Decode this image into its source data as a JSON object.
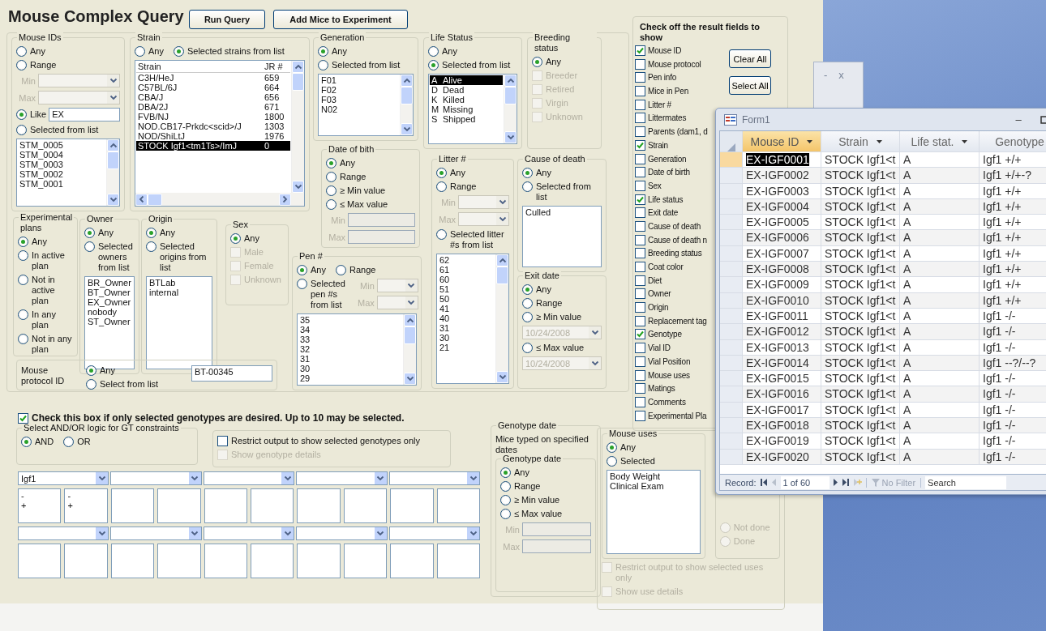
{
  "title": "Mouse Complex Query",
  "toolbar": [
    "Run Query",
    "Add Mice to Experiment"
  ],
  "groups": [
    {
      "title": "Mouse IDs",
      "items": [
        {
          "kind": "radio",
          "label": "Any",
          "selected": false,
          "disabled": false
        },
        {
          "kind": "radio",
          "label": "Range",
          "selected": false,
          "disabled": false
        },
        {
          "kind": "combo",
          "label": "Min",
          "disabled": true
        },
        {
          "kind": "combo",
          "label": "Max",
          "disabled": true
        },
        {
          "kind": "radio_input",
          "label": "Like",
          "value": "EX",
          "selected": true,
          "disabled": false
        },
        {
          "kind": "radio",
          "label": "Selected from list",
          "selected": false,
          "disabled": false
        },
        {
          "kind": "list",
          "rows": [
            {
              "cells": [
                "STM_0005"
              ],
              "selected": false
            },
            {
              "cells": [
                "STM_0004"
              ],
              "selected": false
            },
            {
              "cells": [
                "STM_0003"
              ],
              "selected": false
            },
            {
              "cells": [
                "STM_0002"
              ],
              "selected": false
            },
            {
              "cells": [
                "STM_0001"
              ],
              "selected": false
            }
          ]
        }
      ]
    },
    {
      "title": "Strain",
      "items": [
        {
          "kind": "row",
          "items": [
            {
              "kind": "radio",
              "label": "Any",
              "selected": false,
              "disabled": false
            },
            {
              "kind": "radio",
              "label": "Selected strains from list",
              "selected": true,
              "disabled": false
            }
          ]
        },
        {
          "kind": "list",
          "header": [
            "Strain",
            "JR #"
          ],
          "rows": [
            {
              "cells": [
                "C3H/HeJ",
                "659"
              ],
              "selected": false
            },
            {
              "cells": [
                "C57BL/6J",
                "664"
              ],
              "selected": false
            },
            {
              "cells": [
                "CBA/J",
                "656"
              ],
              "selected": false
            },
            {
              "cells": [
                "DBA/2J",
                "671"
              ],
              "selected": false
            },
            {
              "cells": [
                "FVB/NJ",
                "1800"
              ],
              "selected": false
            },
            {
              "cells": [
                "NOD.CB17-Prkdc<scid>/J",
                "1303"
              ],
              "selected": false
            },
            {
              "cells": [
                "NOD/ShiLtJ",
                "1976"
              ],
              "selected": false
            },
            {
              "cells": [
                "STOCK Igf1<tm1Ts>/ImJ",
                "0"
              ],
              "selected": true
            }
          ]
        }
      ]
    },
    {
      "title": "Generation",
      "items": [
        {
          "kind": "radio",
          "label": "Any",
          "selected": true,
          "disabled": false
        },
        {
          "kind": "radio",
          "label": "Selected from list",
          "selected": false,
          "disabled": false
        },
        {
          "kind": "list",
          "rows": [
            {
              "cells": [
                "F01"
              ],
              "selected": false
            },
            {
              "cells": [
                "F02"
              ],
              "selected": false
            },
            {
              "cells": [
                "F03"
              ],
              "selected": false
            },
            {
              "cells": [
                "N02"
              ],
              "selected": false
            }
          ]
        }
      ]
    },
    {
      "title": "Life Status",
      "items": [
        {
          "kind": "radio",
          "label": "Any",
          "selected": false,
          "disabled": false
        },
        {
          "kind": "radio",
          "label": "Selected from list",
          "selected": true,
          "disabled": false
        },
        {
          "kind": "list",
          "rows": [
            {
              "cells": [
                "A",
                "Alive"
              ],
              "selected": true
            },
            {
              "cells": [
                "D",
                "Dead"
              ],
              "selected": false
            },
            {
              "cells": [
                "K",
                "Killed"
              ],
              "selected": false
            },
            {
              "cells": [
                "M",
                "Missing"
              ],
              "selected": false
            },
            {
              "cells": [
                "S",
                "Shipped"
              ],
              "selected": false
            }
          ]
        }
      ]
    },
    {
      "title": "Breeding status",
      "items": [
        {
          "kind": "radio",
          "label": "Any",
          "selected": true,
          "disabled": false
        },
        {
          "kind": "check",
          "label": "Breeder",
          "checked": false,
          "disabled": true
        },
        {
          "kind": "check",
          "label": "Retired",
          "checked": false,
          "disabled": true
        },
        {
          "kind": "check",
          "label": "Virgin",
          "checked": false,
          "disabled": true
        },
        {
          "kind": "check",
          "label": "Unknown",
          "checked": false,
          "disabled": true
        }
      ]
    },
    {
      "title": "Date of bith",
      "items": [
        {
          "kind": "radio",
          "label": "Any",
          "selected": true,
          "disabled": false
        },
        {
          "kind": "radio",
          "label": "Range",
          "selected": false,
          "disabled": false
        },
        {
          "kind": "radio",
          "label": "≥ Min value",
          "selected": false,
          "disabled": false
        },
        {
          "kind": "radio",
          "label": "≤ Max value",
          "selected": false,
          "disabled": false
        },
        {
          "kind": "field",
          "label": "Min",
          "disabled": true
        },
        {
          "kind": "field",
          "label": "Max",
          "disabled": true
        }
      ]
    },
    {
      "title": "Litter #",
      "items": [
        {
          "kind": "radio",
          "label": "Any",
          "selected": true,
          "disabled": false
        },
        {
          "kind": "radio",
          "label": "Range",
          "selected": false,
          "disabled": false
        },
        {
          "kind": "combo",
          "label": "Min",
          "disabled": true
        },
        {
          "kind": "combo",
          "label": "Max",
          "disabled": true
        },
        {
          "kind": "radio",
          "label": "Selected litter #s from list",
          "selected": false,
          "disabled": false
        },
        {
          "kind": "list",
          "rows": [
            {
              "cells": [
                "62"
              ],
              "selected": false
            },
            {
              "cells": [
                "61"
              ],
              "selected": false
            },
            {
              "cells": [
                "60"
              ],
              "selected": false
            },
            {
              "cells": [
                "51"
              ],
              "selected": false
            },
            {
              "cells": [
                "50"
              ],
              "selected": false
            },
            {
              "cells": [
                "41"
              ],
              "selected": false
            },
            {
              "cells": [
                "40"
              ],
              "selected": false
            },
            {
              "cells": [
                "31"
              ],
              "selected": false
            },
            {
              "cells": [
                "30"
              ],
              "selected": false
            },
            {
              "cells": [
                "21"
              ],
              "selected": false
            }
          ]
        }
      ]
    },
    {
      "title": "Cause of death",
      "items": [
        {
          "kind": "radio",
          "label": "Any",
          "selected": true,
          "disabled": false
        },
        {
          "kind": "radio",
          "label": "Selected from list",
          "selected": false,
          "disabled": false
        },
        {
          "kind": "list",
          "rows": [
            {
              "cells": [
                "Culled"
              ],
              "selected": false
            }
          ]
        }
      ]
    },
    {
      "title": "Exit date",
      "items": [
        {
          "kind": "radio",
          "label": "Any",
          "selected": true,
          "disabled": false
        },
        {
          "kind": "radio",
          "label": "Range",
          "selected": false,
          "disabled": false
        },
        {
          "kind": "radio",
          "label": "≥ Min value",
          "selected": false,
          "disabled": false
        },
        {
          "kind": "combo",
          "value": "10/24/2008",
          "disabled": true
        },
        {
          "kind": "radio",
          "label": "≤ Max value",
          "selected": false,
          "disabled": false
        },
        {
          "kind": "combo",
          "value": "10/24/2008",
          "disabled": true
        }
      ]
    },
    {
      "title": "Experimental plans",
      "items": [
        {
          "kind": "radio",
          "label": "Any",
          "selected": true,
          "disabled": false
        },
        {
          "kind": "radio",
          "label": "In active plan",
          "selected": false,
          "disabled": false
        },
        {
          "kind": "radio",
          "label": "Not in active plan",
          "selected": false,
          "disabled": false
        },
        {
          "kind": "radio",
          "label": "In any plan",
          "selected": false,
          "disabled": false
        },
        {
          "kind": "radio",
          "label": "Not in any plan",
          "selected": false,
          "disabled": false
        }
      ]
    },
    {
      "title": "Owner",
      "items": [
        {
          "kind": "radio",
          "label": "Any",
          "selected": true,
          "disabled": false
        },
        {
          "kind": "radio",
          "label": "Selected owners from list",
          "selected": false,
          "disabled": false
        },
        {
          "kind": "list",
          "rows": [
            {
              "cells": [
                "BR_Owner"
              ],
              "selected": false
            },
            {
              "cells": [
                "BT_Owner"
              ],
              "selected": false
            },
            {
              "cells": [
                "EX_Owner"
              ],
              "selected": false
            },
            {
              "cells": [
                "nobody"
              ],
              "selected": false
            },
            {
              "cells": [
                "ST_Owner"
              ],
              "selected": false
            }
          ]
        }
      ]
    },
    {
      "title": "Origin",
      "items": [
        {
          "kind": "radio",
          "label": "Any",
          "selected": true,
          "disabled": false
        },
        {
          "kind": "radio",
          "label": "Selected origins from list",
          "selected": false,
          "disabled": false
        },
        {
          "kind": "list",
          "rows": [
            {
              "cells": [
                "BTLab"
              ],
              "selected": false
            },
            {
              "cells": [
                "internal"
              ],
              "selected": false
            }
          ]
        }
      ]
    },
    {
      "title": "Sex",
      "items": [
        {
          "kind": "radio",
          "label": "Any",
          "selected": true,
          "disabled": false
        },
        {
          "kind": "check",
          "label": "Male",
          "checked": false,
          "disabled": true
        },
        {
          "kind": "check",
          "label": "Female",
          "checked": false,
          "disabled": true
        },
        {
          "kind": "check",
          "label": "Unknown",
          "checked": false,
          "disabled": true
        }
      ]
    },
    {
      "title": "Pen #",
      "items": [
        {
          "kind": "row",
          "items": [
            {
              "kind": "radio",
              "label": "Any",
              "selected": true,
              "disabled": false
            },
            {
              "kind": "radio",
              "label": "Range",
              "selected": false,
              "disabled": false
            }
          ]
        },
        {
          "kind": "row",
          "items": [
            {
              "kind": "radio",
              "label": "Selected pen #s from list",
              "selected": false,
              "disabled": false
            },
            {
              "kind": "col",
              "items": [
                {
                  "kind": "combo",
                  "label": "Min",
                  "disabled": true
                },
                {
                  "kind": "combo",
                  "label": "Max",
                  "disabled": true
                }
              ]
            }
          ]
        },
        {
          "kind": "list",
          "rows": [
            {
              "cells": [
                "35"
              ],
              "selected": false
            },
            {
              "cells": [
                "34"
              ],
              "selected": false
            },
            {
              "cells": [
                "33"
              ],
              "selected": false
            },
            {
              "cells": [
                "32"
              ],
              "selected": false
            },
            {
              "cells": [
                "31"
              ],
              "selected": false
            },
            {
              "cells": [
                "30"
              ],
              "selected": false
            },
            {
              "cells": [
                "29"
              ],
              "selected": false
            }
          ]
        }
      ]
    },
    {
      "items": [
        {
          "kind": "row",
          "items": [
            {
              "kind": "text",
              "text": "Mouse protocol ID"
            },
            {
              "kind": "col",
              "items": [
                {
                  "kind": "radio",
                  "label": "Any",
                  "selected": true,
                  "disabled": false
                },
                {
                  "kind": "radio",
                  "label": "Select from list",
                  "selected": false,
                  "disabled": false
                }
              ]
            },
            {
              "kind": "list",
              "rows": [
                {
                  "cells": [
                    "BT-00345"
                  ],
                  "selected": false
                }
              ]
            }
          ]
        }
      ]
    },
    {
      "title": "Select AND/OR logic for GT constraints",
      "items": [
        {
          "kind": "row",
          "items": [
            {
              "kind": "radio",
              "label": "AND",
              "selected": true,
              "disabled": false
            },
            {
              "kind": "radio",
              "label": "OR",
              "selected": false,
              "disabled": false
            }
          ]
        }
      ]
    },
    {
      "items": [
        {
          "kind": "check",
          "label": "Restrict output to show selected genotypes only",
          "checked": false,
          "disabled": false
        },
        {
          "kind": "check",
          "label": "Show genotype details",
          "checked": false,
          "disabled": true
        }
      ]
    },
    {
      "title": "Genotype date",
      "items": [
        {
          "kind": "text",
          "text": "Mice typed  on specified dates"
        },
        {
          "kind": "group",
          "title": "Genotype date",
          "items": [
            {
              "kind": "radio",
              "label": "Any",
              "selected": true,
              "disabled": false
            },
            {
              "kind": "radio",
              "label": "Range",
              "selected": false,
              "disabled": false
            },
            {
              "kind": "radio",
              "label": "≥ Min value",
              "selected": false,
              "disabled": false
            },
            {
              "kind": "radio",
              "label": "≤ Max value",
              "selected": false,
              "disabled": false
            },
            {
              "kind": "field",
              "label": "Min",
              "disabled": true
            },
            {
              "kind": "field",
              "label": "Max",
              "disabled": true
            }
          ]
        }
      ]
    },
    {
      "items": [
        {
          "kind": "row",
          "items": [
            {
              "kind": "group",
              "title": "Mouse uses",
              "items": [
                {
                  "kind": "radio",
                  "label": "Any",
                  "selected": true,
                  "disabled": false
                },
                {
                  "kind": "radio",
                  "label": "Selected",
                  "selected": false,
                  "disabled": false
                },
                {
                  "kind": "list",
                  "rows": [
                    {
                      "cells": [
                        "Body Weight"
                      ],
                      "selected": false
                    },
                    {
                      "cells": [
                        "Clinical Exam"
                      ],
                      "selected": false
                    }
                  ]
                }
              ]
            },
            {
              "kind": "group",
              "items": [
                {
                  "kind": "radio",
                  "label": "Not done",
                  "selected": false,
                  "disabled": true
                },
                {
                  "kind": "radio",
                  "label": "Done",
                  "selected": false,
                  "disabled": true
                }
              ]
            }
          ]
        },
        {
          "kind": "check",
          "label": "Restrict output to show selected uses only",
          "checked": false,
          "disabled": true
        },
        {
          "kind": "check",
          "label": "Show use details",
          "checked": false,
          "disabled": true
        }
      ]
    }
  ],
  "genotype_filter": {
    "check": {
      "label": "Check this box if only selected genotypes are desired.  Up to 10 may be selected.",
      "checked": true,
      "disabled": false
    },
    "selectors": [
      {
        "gene": "Igf1",
        "boxes": [
          [
            "-",
            "+"
          ],
          [
            "-",
            "+"
          ]
        ]
      }
    ]
  },
  "result_fields": {
    "title": "Check off the result fields to show",
    "buttons": [
      "Clear All",
      "Select All"
    ],
    "fields": [
      {
        "label": "Mouse ID",
        "checked": true
      },
      {
        "label": "Mouse protocol",
        "checked": false
      },
      {
        "label": "Pen info",
        "checked": false
      },
      {
        "label": "Mice in Pen",
        "checked": false
      },
      {
        "label": "Litter #",
        "checked": false
      },
      {
        "label": "Littermates",
        "checked": false
      },
      {
        "label": "Parents (dam1, d",
        "checked": false
      },
      {
        "label": "Strain",
        "checked": true
      },
      {
        "label": "Generation",
        "checked": false
      },
      {
        "label": "Date of birth",
        "checked": false
      },
      {
        "label": "Sex",
        "checked": false
      },
      {
        "label": "Life status",
        "checked": true
      },
      {
        "label": "Exit date",
        "checked": false
      },
      {
        "label": "Cause of death",
        "checked": false
      },
      {
        "label": "Cause of death n",
        "checked": false
      },
      {
        "label": "Breeding status",
        "checked": false
      },
      {
        "label": "Coat color",
        "checked": false
      },
      {
        "label": "Diet",
        "checked": false
      },
      {
        "label": "Owner",
        "checked": false
      },
      {
        "label": "Origin",
        "checked": false
      },
      {
        "label": "Replacement tag",
        "checked": false
      },
      {
        "label": "Genotype",
        "checked": true
      },
      {
        "label": "Vial ID",
        "checked": false
      },
      {
        "label": "Vial Position",
        "checked": false
      },
      {
        "label": "Mouse uses",
        "checked": false
      },
      {
        "label": "Matings",
        "checked": false
      },
      {
        "label": "Comments",
        "checked": false
      },
      {
        "label": "Experimental Pla",
        "checked": false
      }
    ]
  },
  "background_window": {
    "controls": [
      "-",
      "x"
    ]
  },
  "form1": {
    "title": "Form1",
    "controls": [
      "–"
    ],
    "columns": [
      {
        "label": "Mouse ID",
        "selected": true,
        "menu": true
      },
      {
        "label": "Strain",
        "selected": false,
        "menu": true
      },
      {
        "label": "Life stat.",
        "selected": false,
        "menu": true
      },
      {
        "label": "Genotype",
        "selected": false,
        "menu": false
      }
    ],
    "rows": [
      {
        "cells": [
          "EX-IGF0001",
          "STOCK Igf1<t",
          "A",
          "Igf1 +/+"
        ],
        "selected": true
      },
      {
        "cells": [
          "EX-IGF0002",
          "STOCK Igf1<t",
          "A",
          "Igf1 +/+-?"
        ],
        "selected": false
      },
      {
        "cells": [
          "EX-IGF0003",
          "STOCK Igf1<t",
          "A",
          "Igf1 +/+"
        ],
        "selected": false
      },
      {
        "cells": [
          "EX-IGF0004",
          "STOCK Igf1<t",
          "A",
          "Igf1 +/+"
        ],
        "selected": false
      },
      {
        "cells": [
          "EX-IGF0005",
          "STOCK Igf1<t",
          "A",
          "Igf1 +/+"
        ],
        "selected": false
      },
      {
        "cells": [
          "EX-IGF0006",
          "STOCK Igf1<t",
          "A",
          "Igf1 +/+"
        ],
        "selected": false
      },
      {
        "cells": [
          "EX-IGF0007",
          "STOCK Igf1<t",
          "A",
          "Igf1 +/+"
        ],
        "selected": false
      },
      {
        "cells": [
          "EX-IGF0008",
          "STOCK Igf1<t",
          "A",
          "Igf1 +/+"
        ],
        "selected": false
      },
      {
        "cells": [
          "EX-IGF0009",
          "STOCK Igf1<t",
          "A",
          "Igf1 +/+"
        ],
        "selected": false
      },
      {
        "cells": [
          "EX-IGF0010",
          "STOCK Igf1<t",
          "A",
          "Igf1 +/+"
        ],
        "selected": false
      },
      {
        "cells": [
          "EX-IGF0011",
          "STOCK Igf1<t",
          "A",
          "Igf1 -/-"
        ],
        "selected": false
      },
      {
        "cells": [
          "EX-IGF0012",
          "STOCK Igf1<t",
          "A",
          "Igf1 -/-"
        ],
        "selected": false
      },
      {
        "cells": [
          "EX-IGF0013",
          "STOCK Igf1<t",
          "A",
          "Igf1 -/-"
        ],
        "selected": false
      },
      {
        "cells": [
          "EX-IGF0014",
          "STOCK Igf1<t",
          "A",
          "Igf1 --?/--?"
        ],
        "selected": false
      },
      {
        "cells": [
          "EX-IGF0015",
          "STOCK Igf1<t",
          "A",
          "Igf1 -/-"
        ],
        "selected": false
      },
      {
        "cells": [
          "EX-IGF0016",
          "STOCK Igf1<t",
          "A",
          "Igf1 -/-"
        ],
        "selected": false
      },
      {
        "cells": [
          "EX-IGF0017",
          "STOCK Igf1<t",
          "A",
          "Igf1 -/-"
        ],
        "selected": false
      },
      {
        "cells": [
          "EX-IGF0018",
          "STOCK Igf1<t",
          "A",
          "Igf1 -/-"
        ],
        "selected": false
      },
      {
        "cells": [
          "EX-IGF0019",
          "STOCK Igf1<t",
          "A",
          "Igf1 -/-"
        ],
        "selected": false
      },
      {
        "cells": [
          "EX-IGF0020",
          "STOCK Igf1<t",
          "A",
          "Igf1 -/-"
        ],
        "selected": false
      }
    ],
    "footer": {
      "label": "Record:",
      "position": "1 of 60",
      "filter": "No Filter",
      "search_placeholder": "Search"
    }
  }
}
